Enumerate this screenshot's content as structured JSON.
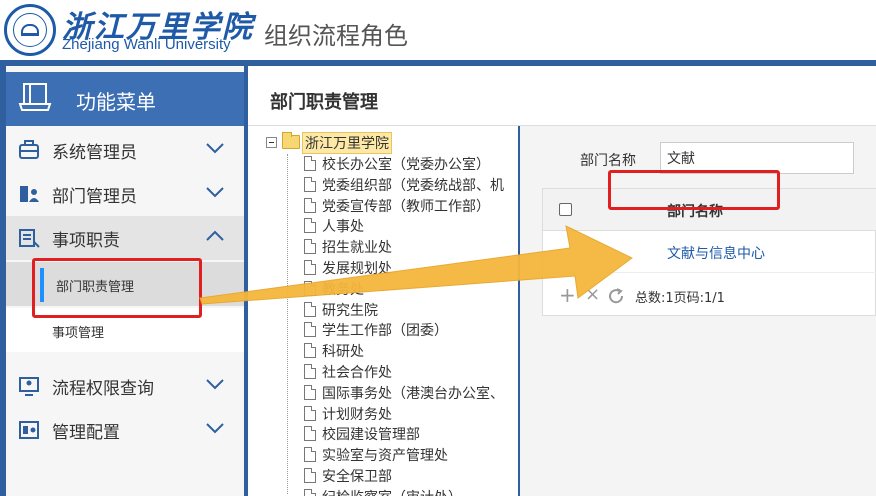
{
  "header": {
    "school_cn": "浙江万里学院",
    "school_en": "Zhejiang Wanli University",
    "system_title": "组织流程角色"
  },
  "sidebar": {
    "title": "功能菜单",
    "items": [
      {
        "label": "系统管理员",
        "icon": "toolbox-icon",
        "expanded": false
      },
      {
        "label": "部门管理员",
        "icon": "user-card-icon",
        "expanded": false
      },
      {
        "label": "事项职责",
        "icon": "list-icon",
        "expanded": true,
        "children": [
          {
            "label": "部门职责管理",
            "active": true
          },
          {
            "label": "事项管理",
            "active": false
          }
        ]
      },
      {
        "label": "流程权限查询",
        "icon": "monitor-user-icon",
        "expanded": false
      },
      {
        "label": "管理配置",
        "icon": "settings-panel-icon",
        "expanded": false
      }
    ]
  },
  "main": {
    "title": "部门职责管理"
  },
  "tree": {
    "root": "浙江万里学院",
    "nodes": [
      "校长办公室（党委办公室）",
      "党委组织部（党委统战部、机",
      "党委宣传部（教师工作部）",
      "人事处",
      "招生就业处",
      "发展规划处",
      "教务处",
      "研究生院",
      "学生工作部（团委）",
      "科研处",
      "社会合作处",
      "国际事务处（港澳台办公室、",
      "计划财务处",
      "校园建设管理部",
      "实验室与资产管理处",
      "安全保卫部",
      "纪检监察室（审计处）"
    ]
  },
  "filter": {
    "label": "部门名称",
    "value": "文献"
  },
  "grid": {
    "column": "部门名称",
    "rows": [
      "文献与信息中心"
    ],
    "footer": "总数:1页码:1/1"
  },
  "colors": {
    "brand_blue": "#2f5f9e",
    "highlight_red": "#e02020",
    "arrow_orange": "#f5b73c"
  }
}
